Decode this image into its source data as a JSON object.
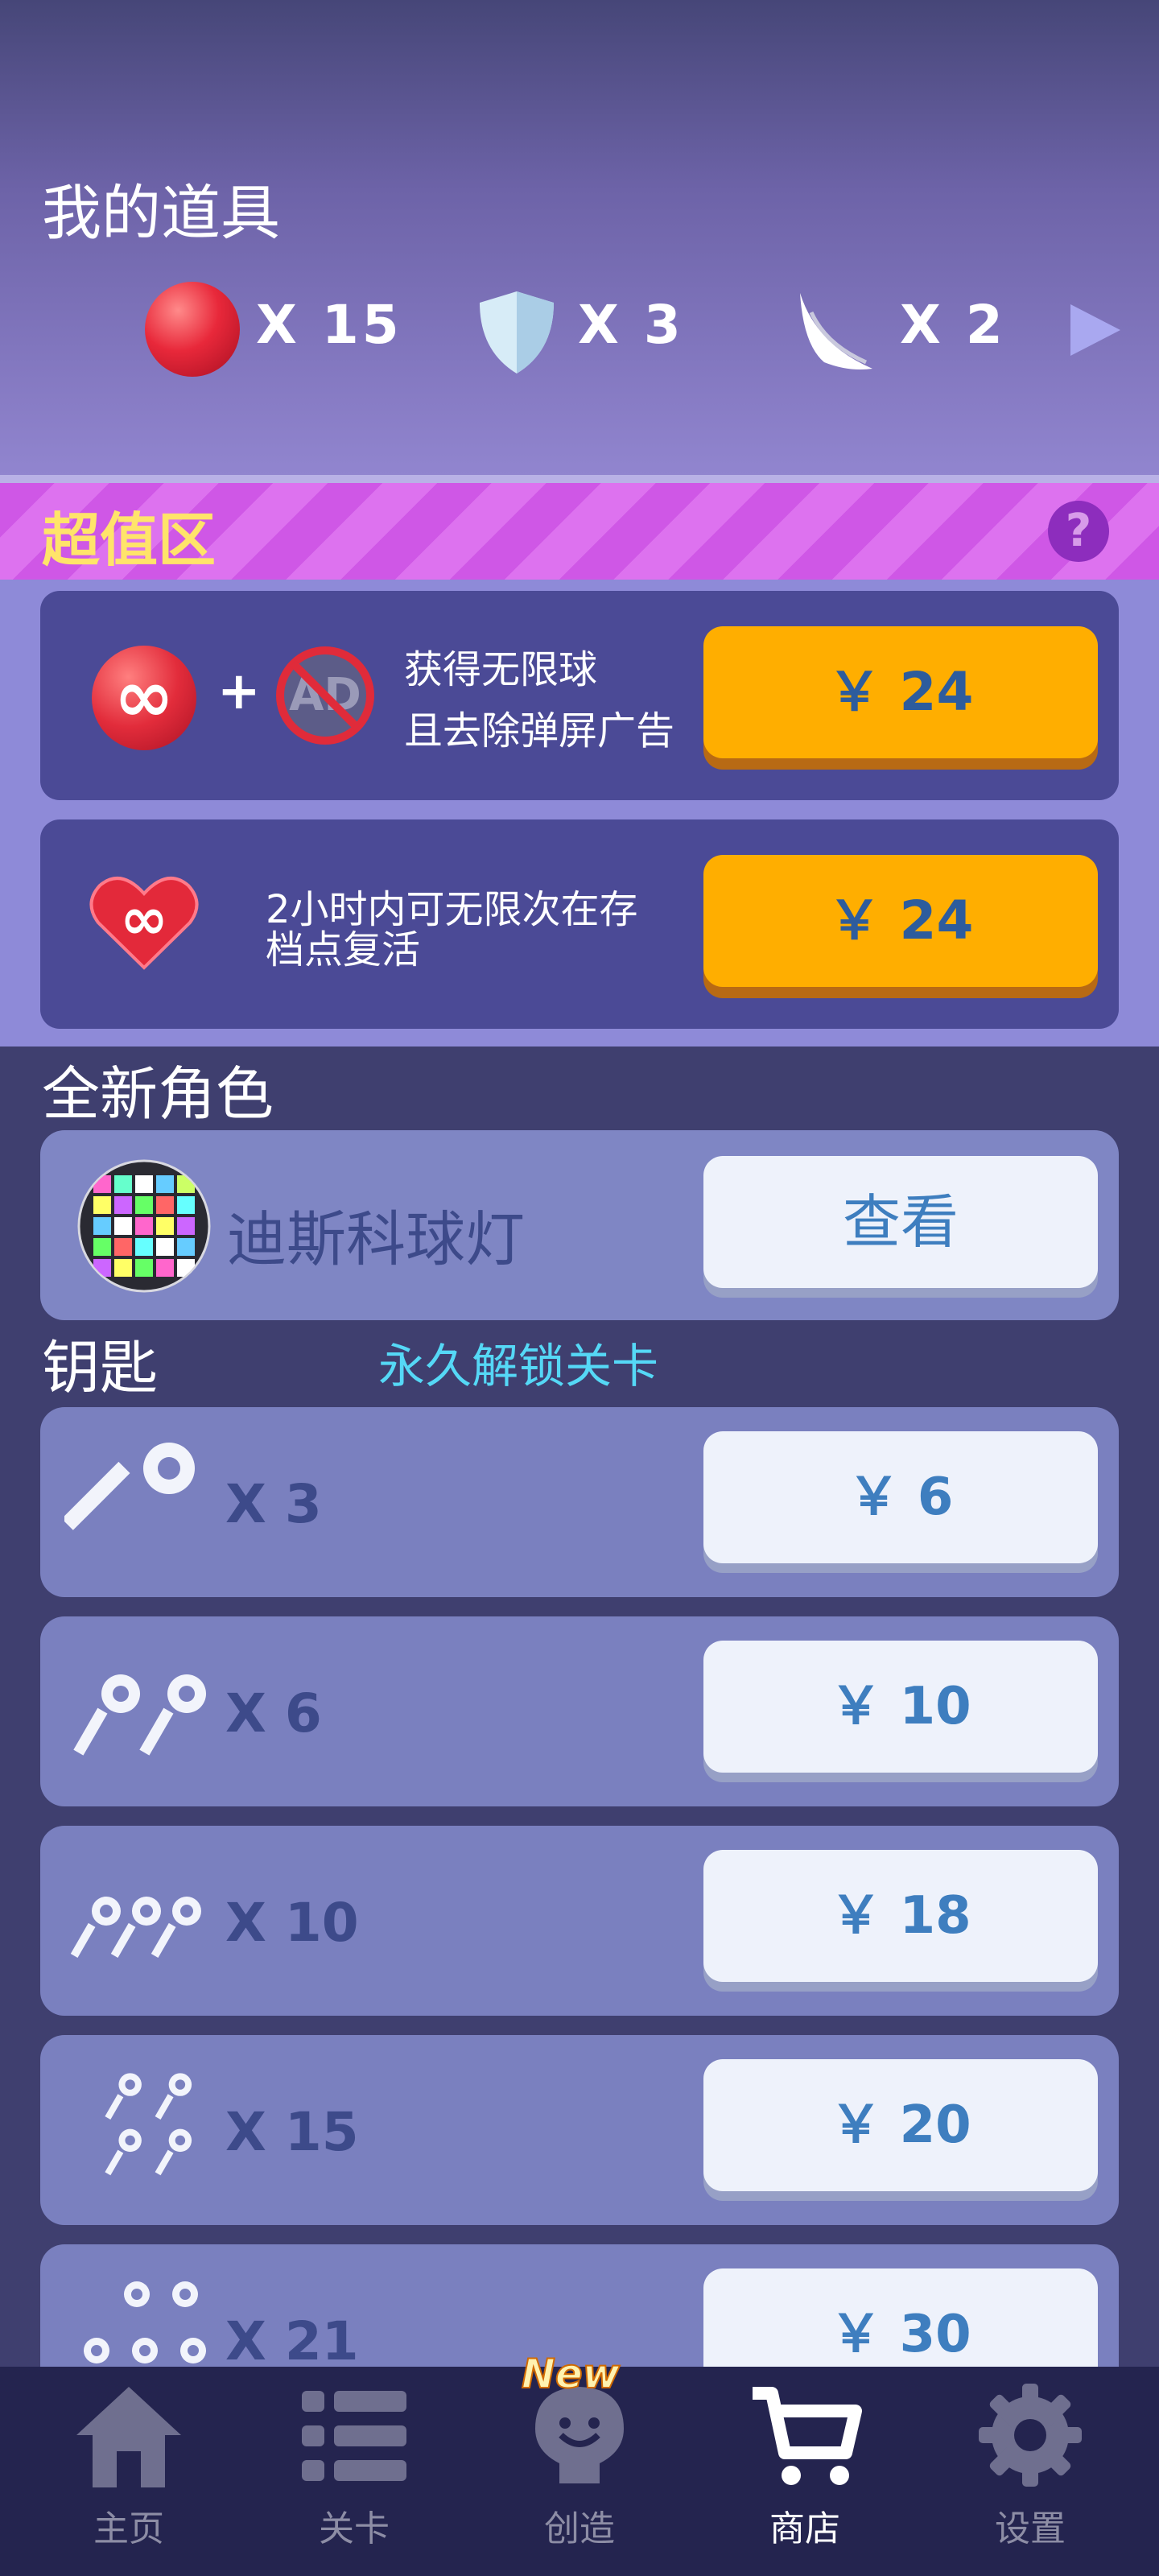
{
  "header": {
    "title": "我的道具",
    "items": [
      {
        "icon": "red-ball-icon",
        "count": "X 15"
      },
      {
        "icon": "shield-icon",
        "count": "X 3"
      },
      {
        "icon": "wing-icon",
        "count": "X 2"
      }
    ]
  },
  "super_value": {
    "title": "超值区",
    "help_label": "?",
    "deals": [
      {
        "line1": "获得无限球",
        "line2": "且去除弹屏广告",
        "price": "￥ 24"
      },
      {
        "line1": "2小时内可无限次在存",
        "line2": "档点复活",
        "price": "￥ 24"
      }
    ]
  },
  "characters": {
    "title": "全新角色",
    "name": "迪斯科球灯",
    "view_label": "查看"
  },
  "keys": {
    "title": "钥匙",
    "subtitle": "永久解锁关卡",
    "packs": [
      {
        "count": "X 3",
        "price": "￥ 6"
      },
      {
        "count": "X 6",
        "price": "￥ 10"
      },
      {
        "count": "X 10",
        "price": "￥ 18"
      },
      {
        "count": "X 15",
        "price": "￥ 20"
      },
      {
        "count": "X 21",
        "price": "￥ 30"
      }
    ]
  },
  "nav": {
    "new_badge": "New",
    "items": [
      {
        "label": "主页",
        "icon": "home-icon"
      },
      {
        "label": "关卡",
        "icon": "list-icon"
      },
      {
        "label": "创造",
        "icon": "bulb-icon"
      },
      {
        "label": "商店",
        "icon": "cart-icon",
        "active": true
      },
      {
        "label": "设置",
        "icon": "gear-icon"
      }
    ]
  }
}
